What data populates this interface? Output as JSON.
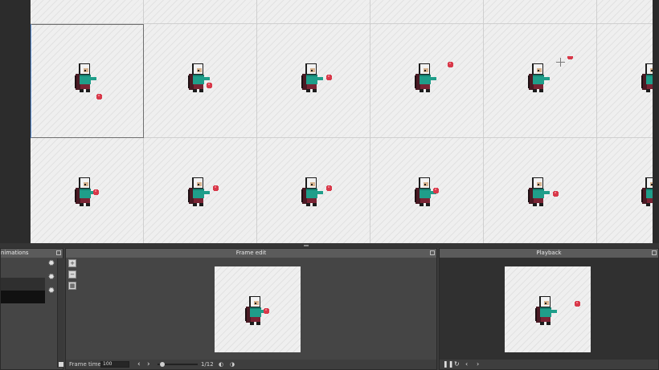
{
  "panels": {
    "animations": {
      "title": "nimations"
    },
    "frame_edit": {
      "title": "Frame edit"
    },
    "playback": {
      "title": "Playback"
    }
  },
  "frame_edit": {
    "frame_time_label": "Frame time",
    "frame_time_value": "100",
    "frame_counter": "1/12",
    "frame_progress": 0.0833
  },
  "icons": {
    "zoom_in": "zoom-in-icon",
    "zoom_out": "zoom-out-icon",
    "fit": "fit-icon",
    "settings": "gear-icon",
    "prev": "chevron-left-icon",
    "next": "chevron-right-icon",
    "pause": "pause-icon",
    "loop": "loop-icon"
  },
  "colors": {
    "panel_bg": "#454545",
    "title_bar": "#5b5b5b",
    "selected_row": "#111111",
    "selection_outline": "#5b8fd6",
    "sprite_shirt": "#1f9e8a",
    "sprite_ball": "#d8394a",
    "sprite_pants": "#7a2434"
  }
}
